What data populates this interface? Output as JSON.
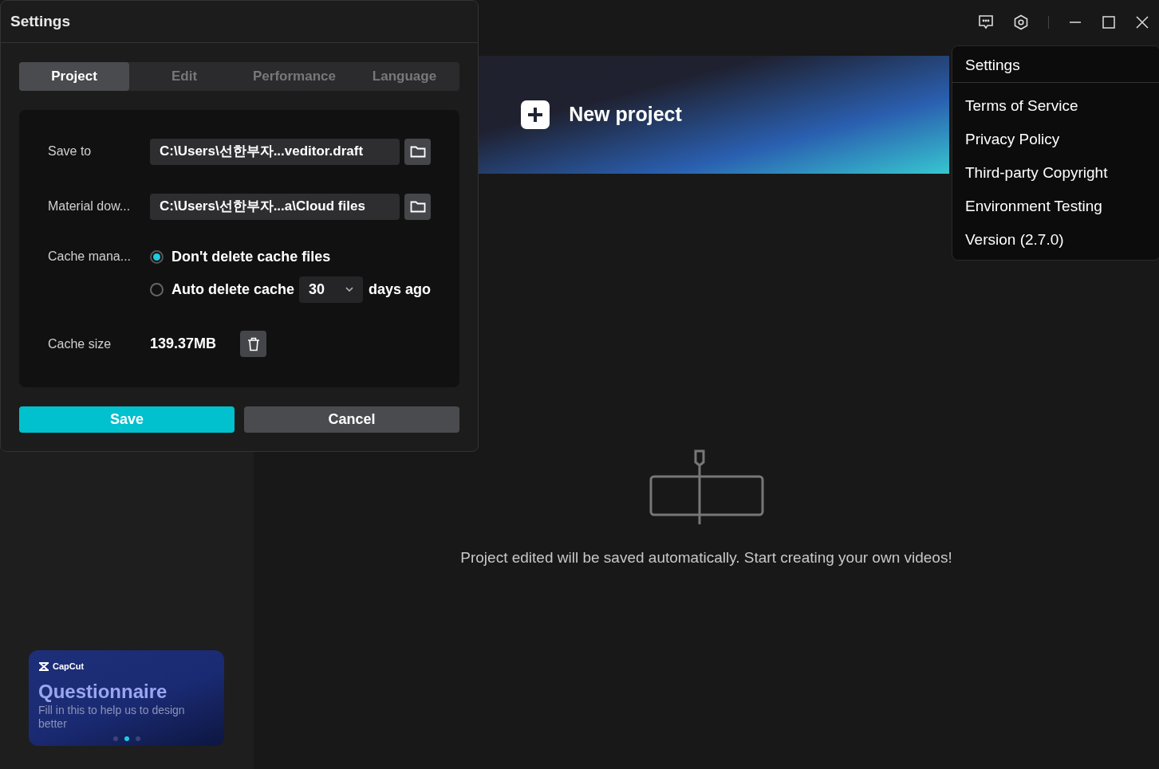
{
  "dialog": {
    "title": "Settings",
    "tabs": [
      {
        "label": "Project",
        "selected": true
      },
      {
        "label": "Edit",
        "selected": false
      },
      {
        "label": "Performance",
        "selected": false
      },
      {
        "label": "Language",
        "selected": false
      }
    ],
    "save_to": {
      "label": "Save to",
      "value": "C:\\Users\\선한부자...veditor.draft"
    },
    "material_download": {
      "label": "Material dow...",
      "value": "C:\\Users\\선한부자...a\\Cloud files"
    },
    "cache_management": {
      "label": "Cache mana...",
      "options": [
        {
          "label": "Don't delete cache files",
          "selected": true
        },
        {
          "label": "Auto delete cache",
          "selected": false
        }
      ],
      "days": "30",
      "suffix": "days ago"
    },
    "cache_size": {
      "label": "Cache size",
      "value": "139.37MB"
    },
    "buttons": {
      "save": "Save",
      "cancel": "Cancel"
    }
  },
  "menu": {
    "items": [
      {
        "label": "Settings",
        "divider_after": true
      },
      {
        "label": "Terms of Service",
        "divider_after": false
      },
      {
        "label": "Privacy Policy",
        "divider_after": false
      },
      {
        "label": "Third-party Copyright",
        "divider_after": false
      },
      {
        "label": "Environment Testing",
        "divider_after": false
      },
      {
        "label": "Version (2.7.0)",
        "divider_after": false
      }
    ]
  },
  "banner": {
    "label": "New project"
  },
  "empty_state": {
    "message": "Project edited will be saved automatically. Start creating your own videos!"
  },
  "promo_card": {
    "brand": "CapCut",
    "title": "Questionnaire",
    "text": "Fill in this to help us to design better",
    "dots": [
      {
        "selected": false
      },
      {
        "selected": true
      },
      {
        "selected": false
      }
    ]
  }
}
